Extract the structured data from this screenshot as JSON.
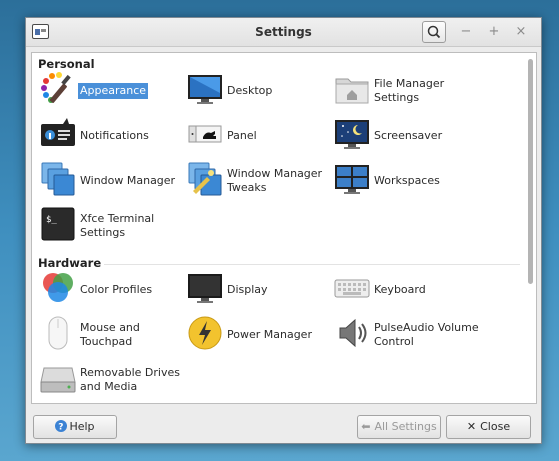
{
  "window": {
    "title": "Settings"
  },
  "sections": [
    {
      "title": "Personal",
      "items": [
        {
          "label": "Appearance",
          "icon": "appearance-icon",
          "selected": true
        },
        {
          "label": "Desktop",
          "icon": "desktop-icon"
        },
        {
          "label": "File Manager\nSettings",
          "icon": "file-manager-icon"
        },
        {
          "label": "Notifications",
          "icon": "notifications-icon"
        },
        {
          "label": "Panel",
          "icon": "panel-icon"
        },
        {
          "label": "Screensaver",
          "icon": "screensaver-icon"
        },
        {
          "label": "Window Manager",
          "icon": "window-manager-icon"
        },
        {
          "label": "Window Manager\nTweaks",
          "icon": "window-manager-tweaks-icon"
        },
        {
          "label": "Workspaces",
          "icon": "workspaces-icon"
        },
        {
          "label": "Xfce Terminal\nSettings",
          "icon": "terminal-icon"
        }
      ]
    },
    {
      "title": "Hardware",
      "items": [
        {
          "label": "Color Profiles",
          "icon": "color-profiles-icon"
        },
        {
          "label": "Display",
          "icon": "display-icon"
        },
        {
          "label": "Keyboard",
          "icon": "keyboard-icon"
        },
        {
          "label": "Mouse and\nTouchpad",
          "icon": "mouse-icon"
        },
        {
          "label": "Power Manager",
          "icon": "power-manager-icon"
        },
        {
          "label": "PulseAudio Volume\nControl",
          "icon": "pulseaudio-icon"
        },
        {
          "label": "Removable Drives\nand Media",
          "icon": "removable-drives-icon"
        }
      ]
    }
  ],
  "buttons": {
    "help": "Help",
    "all_settings": "All Settings",
    "close": "Close"
  },
  "title_buttons": {
    "minimize": "−",
    "maximize": "+",
    "close": "×"
  },
  "colors": {
    "selection": "#4a90d9"
  }
}
